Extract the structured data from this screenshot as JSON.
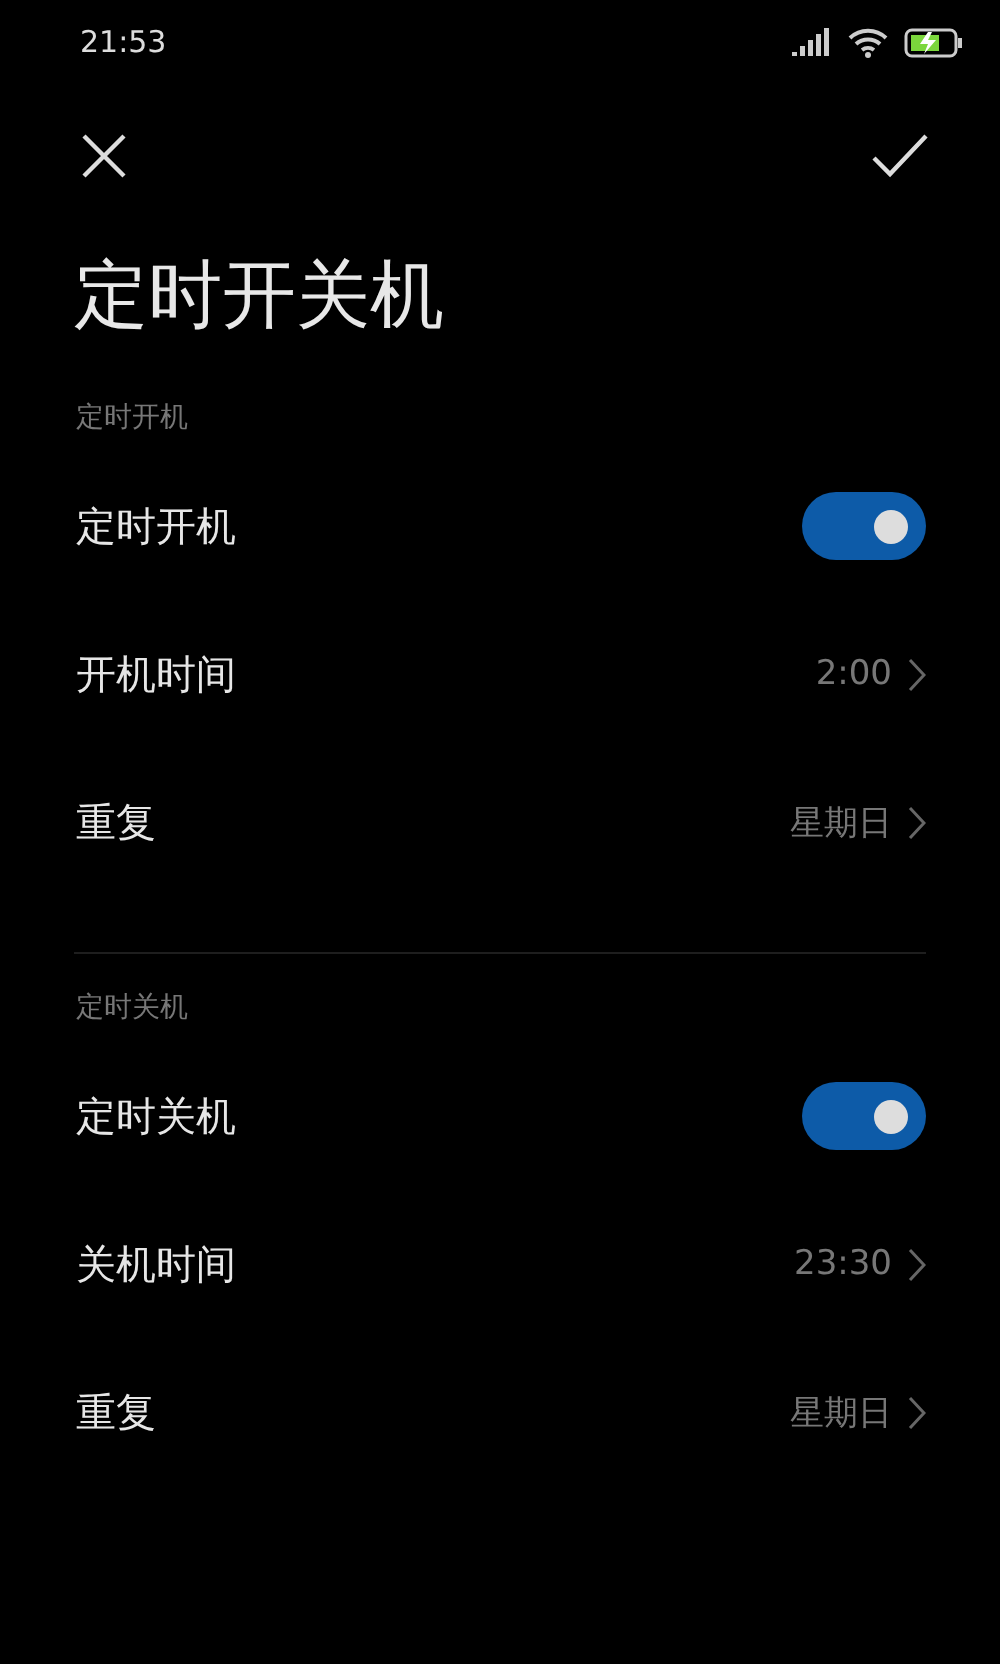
{
  "status_bar": {
    "time": "21:53"
  },
  "header": {
    "title": "定时开关机"
  },
  "sections": [
    {
      "label": "定时开机",
      "rows": [
        {
          "kind": "toggle",
          "label": "定时开机",
          "on": true
        },
        {
          "kind": "value",
          "label": "开机时间",
          "value": "2:00"
        },
        {
          "kind": "value",
          "label": "重复",
          "value": "星期日"
        }
      ]
    },
    {
      "label": "定时关机",
      "rows": [
        {
          "kind": "toggle",
          "label": "定时关机",
          "on": true
        },
        {
          "kind": "value",
          "label": "关机时间",
          "value": "23:30"
        },
        {
          "kind": "value",
          "label": "重复",
          "value": "星期日"
        }
      ]
    }
  ]
}
